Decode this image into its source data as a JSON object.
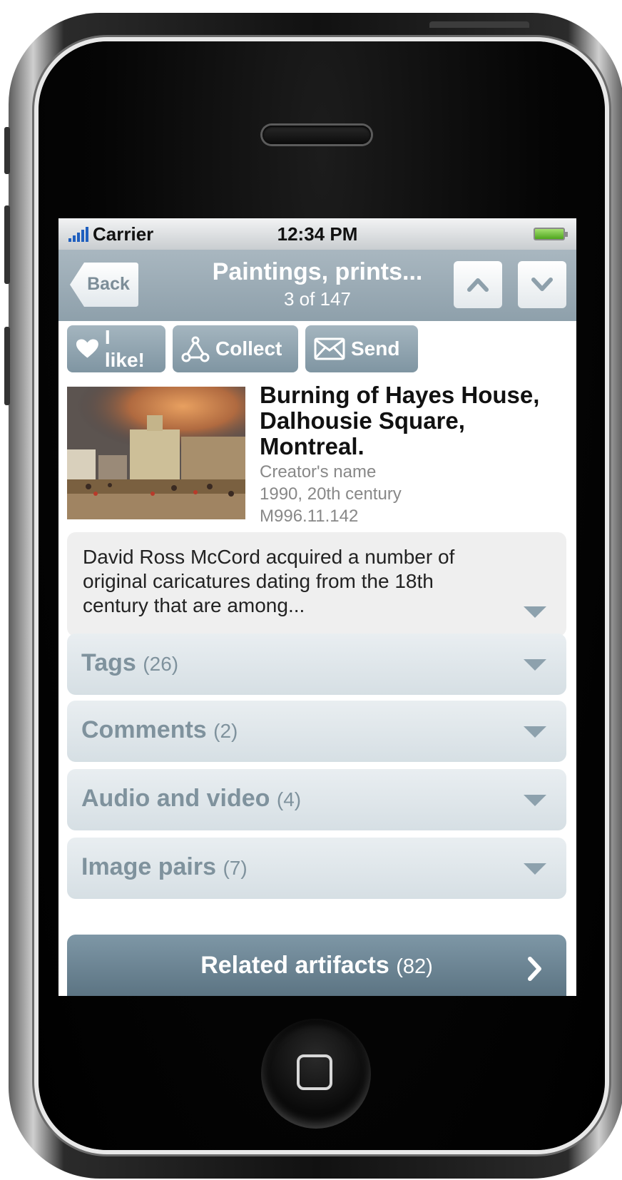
{
  "status_bar": {
    "carrier": "Carrier",
    "time": "12:34 PM"
  },
  "nav": {
    "back_label": "Back",
    "title": "Paintings, prints...",
    "position": "3 of 147"
  },
  "actions": [
    {
      "label": "I like!",
      "icon": "heart-icon"
    },
    {
      "label": "Collect",
      "icon": "network-icon"
    },
    {
      "label": "Send",
      "icon": "envelope-icon"
    }
  ],
  "artifact": {
    "title_lines": [
      "Burning of Hayes House,",
      "Dalhousie Square,",
      "Montreal."
    ],
    "creator": "Creator's name",
    "date": "1990, 20th century",
    "accession": "M996.11.142"
  },
  "description": {
    "lines": [
      "David Ross McCord acquired a number of",
      "original caricatures dating from the 18th",
      "century that are among..."
    ]
  },
  "sections": [
    {
      "label": "Tags",
      "count": "(26)"
    },
    {
      "label": "Comments",
      "count": "(2)"
    },
    {
      "label": "Audio and video",
      "count": "(4)"
    },
    {
      "label": "Image pairs",
      "count": "(7)"
    }
  ],
  "related": {
    "label": "Related artifacts",
    "count": "(82)"
  },
  "colors": {
    "nav_bg": "#98a9b4",
    "button_bg": "#8fa3af",
    "related_bg": "#6a8392"
  }
}
